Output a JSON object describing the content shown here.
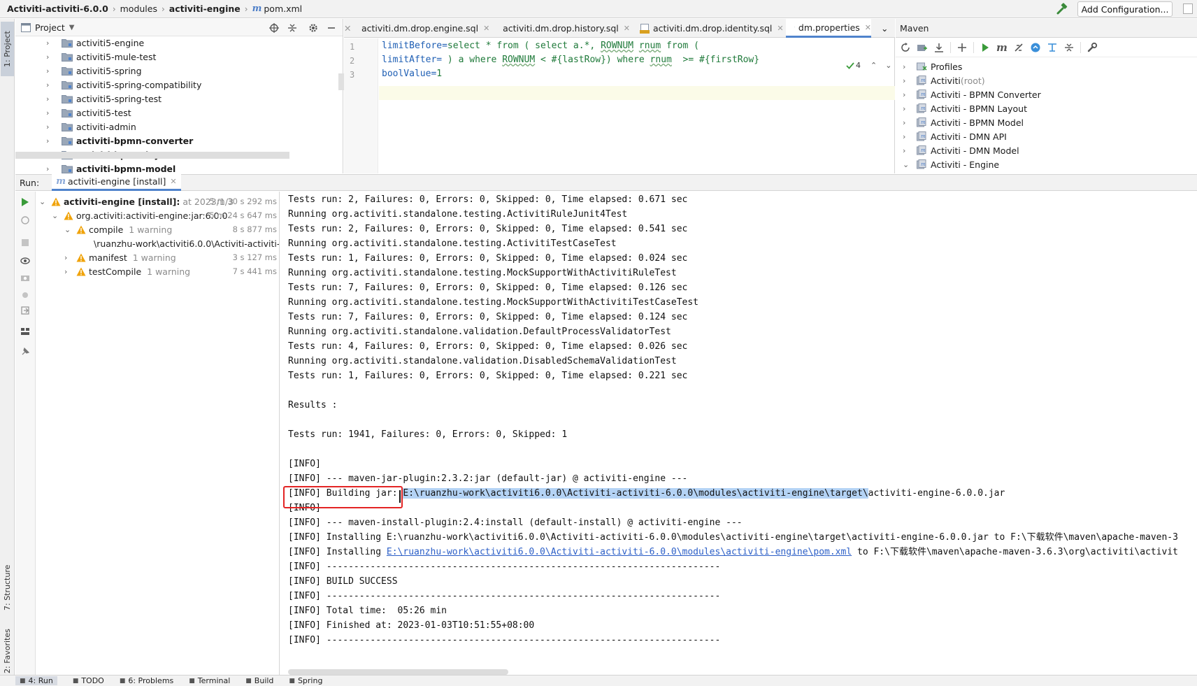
{
  "navbar": {
    "crumbs": [
      {
        "label": "Activiti-activiti-6.0.0",
        "bold": true
      },
      {
        "label": "modules",
        "bold": false
      },
      {
        "label": "activiti-engine",
        "bold": true
      },
      {
        "label": "pom.xml",
        "bold": false
      }
    ],
    "add_configuration": "Add Configuration..."
  },
  "left_strip": {
    "project_tab": "1: Project",
    "structure_tab": "7: Structure",
    "favorites_tab": "2: Favorites"
  },
  "project": {
    "title": "Project",
    "items": [
      {
        "label": "activiti5-engine",
        "bold": false
      },
      {
        "label": "activiti5-mule-test",
        "bold": false
      },
      {
        "label": "activiti5-spring",
        "bold": false
      },
      {
        "label": "activiti5-spring-compatibility",
        "bold": false
      },
      {
        "label": "activiti5-spring-test",
        "bold": false
      },
      {
        "label": "activiti5-test",
        "bold": false
      },
      {
        "label": "activiti-admin",
        "bold": false
      },
      {
        "label": "activiti-bpmn-converter",
        "bold": true
      },
      {
        "label": "activiti-bpmn-layout",
        "bold": true
      },
      {
        "label": "activiti-bpmn-model",
        "bold": true
      }
    ]
  },
  "editor": {
    "tabs": [
      {
        "label": "activiti.dm.drop.engine.sql",
        "active": false
      },
      {
        "label": "activiti.dm.drop.history.sql",
        "active": false
      },
      {
        "label": "activiti.dm.drop.identity.sql",
        "active": false
      },
      {
        "label": "dm.properties",
        "active": true
      }
    ],
    "line_numbers": [
      "1",
      "2",
      "3"
    ],
    "inspection_count": "4",
    "line1_key": "limitBefore",
    "line1_value_a": "select * from ( select a.*, ",
    "line1_value_b": "ROWNUM",
    "line1_value_c": " ",
    "line1_value_d": "rnum",
    "line1_value_e": " from (",
    "line2_key": "limitAfter",
    "line2_value_a": " ) a where ",
    "line2_value_b": "ROWNUM",
    "line2_value_c": " < #{lastRow}) where ",
    "line2_value_d": "rnum",
    "line2_value_e": "  >= #{firstRow}",
    "line3_key": "boolValue",
    "line3_value": "1"
  },
  "maven": {
    "title": "Maven",
    "items": [
      {
        "label": "Profiles",
        "suffix": ""
      },
      {
        "label": "Activiti",
        "suffix": " (root)"
      },
      {
        "label": "Activiti - BPMN Converter",
        "suffix": ""
      },
      {
        "label": "Activiti - BPMN Layout",
        "suffix": ""
      },
      {
        "label": "Activiti - BPMN Model",
        "suffix": ""
      },
      {
        "label": "Activiti - DMN API",
        "suffix": ""
      },
      {
        "label": "Activiti - DMN Model",
        "suffix": ""
      },
      {
        "label": "Activiti - Engine",
        "suffix": ""
      }
    ]
  },
  "run": {
    "label": "Run:",
    "tab": "activiti-engine [install]",
    "tree": {
      "root_label": "activiti-engine [install]:",
      "root_meta": "at 2023/1/3",
      "root_time": "5 m 30 s 292 ms",
      "module_label": "org.activiti:activiti-engine:jar:6.0.0",
      "module_time": "5 m 24 s 647 ms",
      "compile_label": "compile",
      "compile_meta": "1 warning",
      "compile_time": "8 s 877 ms",
      "warn_path": "\\ruanzhu-work\\activiti6.0.0\\Activiti-activiti-6.",
      "manifest_label": "manifest",
      "manifest_meta": "1 warning",
      "manifest_time": "3 s 127 ms",
      "testcompile_label": "testCompile",
      "testcompile_meta": "1 warning",
      "testcompile_time": "7 s 441 ms"
    }
  },
  "console": {
    "lines": [
      "Tests run: 2, Failures: 0, Errors: 0, Skipped: 0, Time elapsed: 0.671 sec",
      "Running org.activiti.standalone.testing.ActivitiRuleJunit4Test",
      "Tests run: 2, Failures: 0, Errors: 0, Skipped: 0, Time elapsed: 0.541 sec",
      "Running org.activiti.standalone.testing.ActivitiTestCaseTest",
      "Tests run: 1, Failures: 0, Errors: 0, Skipped: 0, Time elapsed: 0.024 sec",
      "Running org.activiti.standalone.testing.MockSupportWithActivitiRuleTest",
      "Tests run: 7, Failures: 0, Errors: 0, Skipped: 0, Time elapsed: 0.126 sec",
      "Running org.activiti.standalone.testing.MockSupportWithActivitiTestCaseTest",
      "Tests run: 7, Failures: 0, Errors: 0, Skipped: 0, Time elapsed: 0.124 sec",
      "Running org.activiti.standalone.validation.DefaultProcessValidatorTest",
      "Tests run: 4, Failures: 0, Errors: 0, Skipped: 0, Time elapsed: 0.026 sec",
      "Running org.activiti.standalone.validation.DisabledSchemaValidationTest",
      "Tests run: 1, Failures: 0, Errors: 0, Skipped: 0, Time elapsed: 0.221 sec",
      "",
      "Results :",
      "",
      "Tests run: 1941, Failures: 0, Errors: 0, Skipped: 1",
      "",
      "[INFO]",
      "[INFO] --- maven-jar-plugin:2.3.2:jar (default-jar) @ activiti-engine ---"
    ],
    "build_prefix": "[INFO] Building jar: ",
    "build_selected": "E:\\ruanzhu-work\\activiti6.0.0\\Activiti-activiti-6.0.0\\modules\\activiti-engine\\target\\",
    "build_rest": "activiti-engine-6.0.0.jar",
    "lines_after": [
      "[INFO]",
      "[INFO] --- maven-install-plugin:2.4:install (default-install) @ activiti-engine ---",
      "[INFO] Installing E:\\ruanzhu-work\\activiti6.0.0\\Activiti-activiti-6.0.0\\modules\\activiti-engine\\target\\activiti-engine-6.0.0.jar to F:\\下载软件\\maven\\apache-maven-3"
    ],
    "installing_prefix": "[INFO] Installing ",
    "installing_link": "E:\\ruanzhu-work\\activiti6.0.0\\Activiti-activiti-6.0.0\\modules\\activiti-engine\\pom.xml",
    "installing_rest": " to F:\\下载软件\\maven\\apache-maven-3.6.3\\org\\activiti\\activit",
    "lines_end": [
      "[INFO] ------------------------------------------------------------------------",
      "[INFO] BUILD SUCCESS",
      "[INFO] ------------------------------------------------------------------------",
      "[INFO] Total time:  05:26 min",
      "[INFO] Finished at: 2023-01-03T10:51:55+08:00",
      "[INFO] ------------------------------------------------------------------------"
    ]
  },
  "bottom": {
    "tabs": [
      {
        "label": "4: Run",
        "icon": "run-icon",
        "active": true
      },
      {
        "label": "TODO",
        "icon": "todo-icon",
        "active": false
      },
      {
        "label": "6: Problems",
        "icon": "problems-icon",
        "active": false
      },
      {
        "label": "Terminal",
        "icon": "terminal-icon",
        "active": false
      },
      {
        "label": "Build",
        "icon": "build-icon",
        "active": false
      },
      {
        "label": "Spring",
        "icon": "spring-icon",
        "active": false
      }
    ]
  },
  "colors": {
    "accent": "#4f83cc",
    "selection": "#b4d3f5",
    "warning": "#f0a30a",
    "highlight_box": "#e32424",
    "run_green": "#3a9b3a"
  }
}
